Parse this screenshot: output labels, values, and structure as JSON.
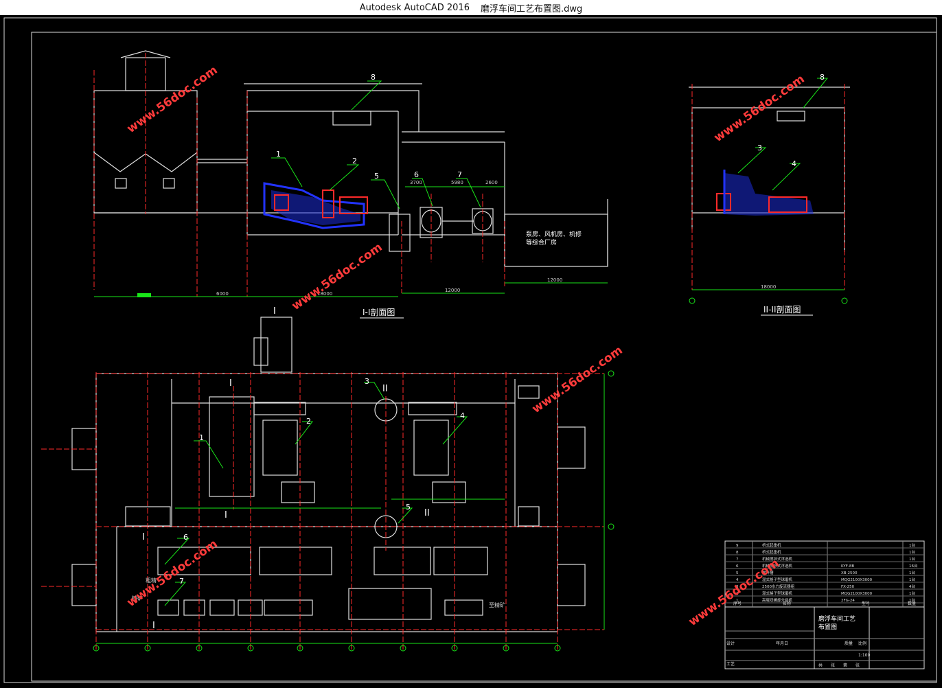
{
  "window": {
    "app_title": "Autodesk AutoCAD 2016",
    "file_name": "磨浮车间工艺布置图.dwg"
  },
  "section1": {
    "title": "I-I剖面图",
    "labels": [
      "1",
      "2",
      "5",
      "6",
      "7",
      "8"
    ],
    "dims": {
      "d3700": "3700",
      "d5980": "5980",
      "d2600": "2600",
      "d6000": "6000",
      "d18000": "18000",
      "d12000a": "12000",
      "d12000b": "12000"
    },
    "room_note_line1": "泵房、风机房、机修",
    "room_note_line2": "等综合厂房"
  },
  "section2": {
    "title": "II-II剖面图",
    "labels": [
      "3",
      "4",
      "8"
    ],
    "dim": "18000"
  },
  "plan": {
    "labels": [
      "1",
      "2",
      "3",
      "4",
      "5",
      "6",
      "7"
    ],
    "section_marks": [
      "I",
      "I",
      "II",
      "II",
      "I",
      "I",
      "I"
    ],
    "note_tailings": "粗精",
    "note_concentrate": "精矿",
    "note_feed": "至精矿"
  },
  "title_block": {
    "drawing_title_line1": "磨浮车间工艺",
    "drawing_title_line2": "布置图",
    "rows": [
      {
        "no": "9",
        "name": "桥式起重机",
        "model": "",
        "qty": "1台"
      },
      {
        "no": "8",
        "name": "桥式起重机",
        "model": "",
        "qty": "1台"
      },
      {
        "no": "7",
        "name": "机械搅拌式浮选机",
        "model": "",
        "qty": "1台"
      },
      {
        "no": "6",
        "name": "机械搅拌式浮选机",
        "model": "KYF-8B",
        "qty": "16台"
      },
      {
        "no": "5",
        "name": "搅拌槽",
        "model": "XB-2500",
        "qty": "1台"
      },
      {
        "no": "4",
        "name": "湿式格子型球磨机",
        "model": "MQG2100X3000",
        "qty": "1台"
      },
      {
        "no": "3",
        "name": "2500水力旋流器组",
        "model": "FX-250",
        "qty": "4台"
      },
      {
        "no": "2",
        "name": "湿式格子型球磨机",
        "model": "MQG2100X3000",
        "qty": "1台"
      },
      {
        "no": "1",
        "name": "高堰双螺旋分级机",
        "model": "2FG-24",
        "qty": "1台"
      }
    ],
    "header_no": "序号",
    "header_name": "名称",
    "header_model": "型号",
    "header_qty": "数量",
    "designer": "设计",
    "process": "工艺",
    "sign": "签名",
    "date": "年月日",
    "scale_label": "比例",
    "scale": "1:100",
    "mass_label": "质量",
    "sheet": "张",
    "total": "共",
    "no_label": "第"
  },
  "watermark": "www.56doc.com",
  "colors": {
    "bg": "#000000",
    "red": "#ff2a2a",
    "green": "#19e619",
    "white": "#e8e8e8",
    "blue": "#2233ff",
    "watermark": "#ff3b3b"
  }
}
